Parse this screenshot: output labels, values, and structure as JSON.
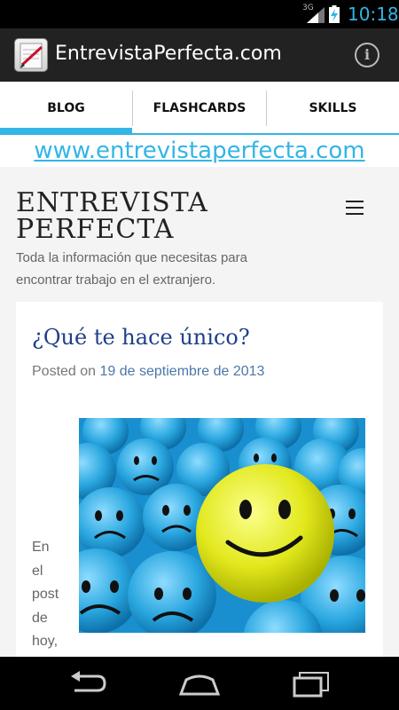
{
  "status_bar": {
    "network": "3G",
    "time": "10:18"
  },
  "action_bar": {
    "title": "EntrevistaPerfecta.com",
    "info_glyph": "i"
  },
  "tabs": [
    {
      "label": "BLOG",
      "selected": true
    },
    {
      "label": "FLASHCARDS",
      "selected": false
    },
    {
      "label": "SKILLS",
      "selected": false
    }
  ],
  "url": {
    "text": "www.entrevistaperfecta.com"
  },
  "site": {
    "title_line1": "ENTREVISTA",
    "title_line2": "PERFECTA",
    "tagline": "Toda la información que necesitas para encontrar trabajo en el extranjero."
  },
  "post": {
    "title": "¿Qué te hace único?",
    "meta_prefix": "Posted on",
    "date": "19 de septiembre de 2013",
    "excerpt_words": [
      "En",
      "el",
      "post",
      "de",
      "hoy,"
    ]
  },
  "colors": {
    "accent": "#33b5e5",
    "post_title": "#1f3f8a",
    "link": "#4a78a8"
  },
  "icons": {
    "app": "notebook-pen-icon",
    "info": "info-icon",
    "menu": "hamburger-menu-icon",
    "nav": [
      "back-icon",
      "home-icon",
      "recent-apps-icon"
    ]
  }
}
